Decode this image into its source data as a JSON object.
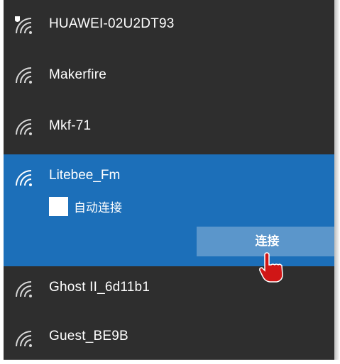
{
  "networks": [
    {
      "name": "HUAWEI-02U2DT93",
      "icon": "wifi-secured-icon"
    },
    {
      "name": "Makerfire",
      "icon": "wifi-icon"
    },
    {
      "name": "Mkf-71",
      "icon": "wifi-icon"
    }
  ],
  "selected_network": {
    "name": "Litebee_Fm",
    "icon": "wifi-icon",
    "auto_connect_label": "自动连接",
    "auto_connect_checked": false,
    "connect_label": "连接"
  },
  "networks_after": [
    {
      "name": "Ghost II_6d11b1",
      "icon": "wifi-icon"
    },
    {
      "name": "Guest_BE9B",
      "icon": "wifi-icon"
    }
  ],
  "colors": {
    "panel_bg": "#2e2e2e",
    "selected_bg": "#1c6fb9",
    "button_bg": "#5b96cb",
    "cursor": "#d01616"
  }
}
